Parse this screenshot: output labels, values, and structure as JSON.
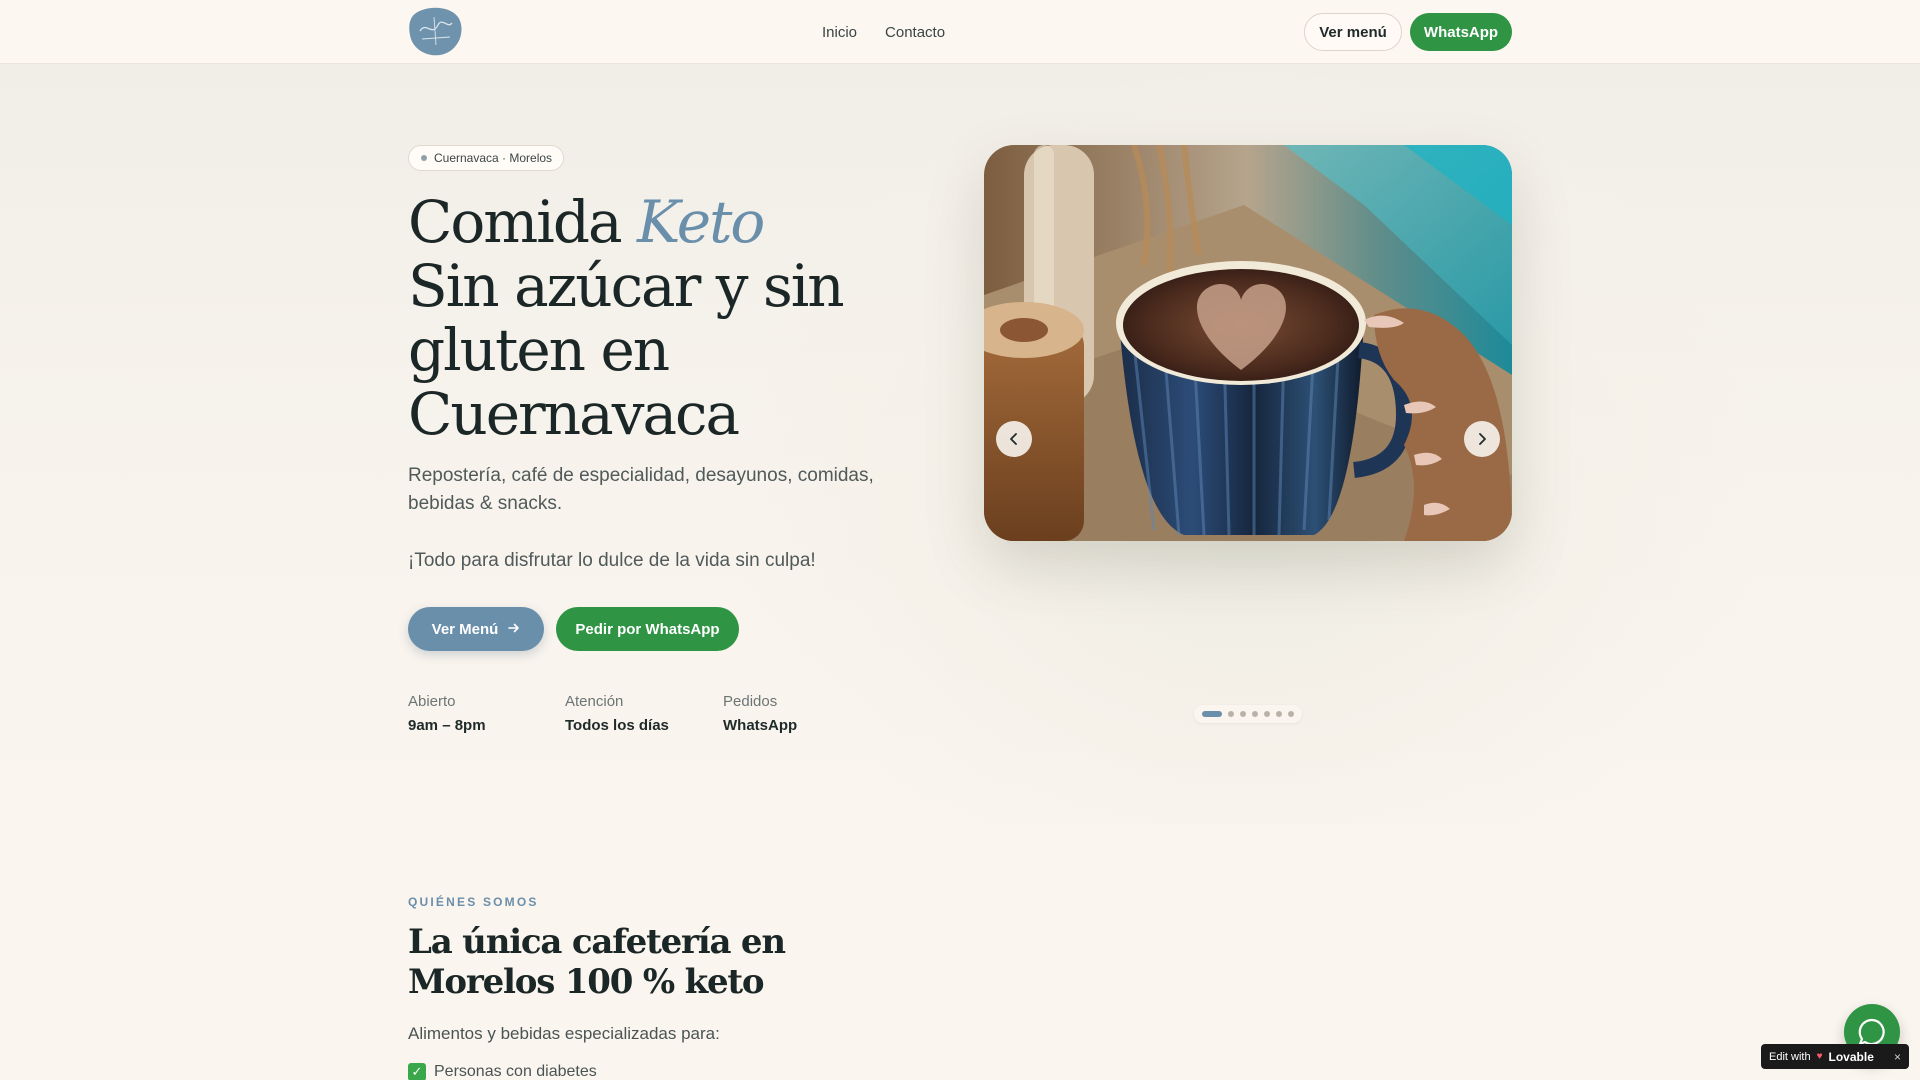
{
  "nav": {
    "links": [
      "Inicio",
      "Contacto"
    ],
    "menu_button": "Ver menú",
    "whatsapp_button": "WhatsApp"
  },
  "hero": {
    "location_pill": "Cuernavaca · Morelos",
    "title_part1": "Comida ",
    "title_highlight": "Keto",
    "title_part2": "Sin azúcar y sin gluten en Cuernavaca",
    "subtitle": "Repostería, café de especialidad, desayunos, comidas, bebidas & snacks.",
    "tagline": "¡Todo para disfrutar lo dulce de la vida sin culpa!",
    "cta_menu": "Ver Menú",
    "cta_whatsapp": "Pedir por WhatsApp",
    "info": [
      {
        "label": "Abierto",
        "value": "9am – 8pm"
      },
      {
        "label": "Atención",
        "value": "Todos los días"
      },
      {
        "label": "Pedidos",
        "value": "WhatsApp"
      }
    ]
  },
  "carousel": {
    "slide_count": 7,
    "active_slide": 1
  },
  "about": {
    "eyebrow": "QUIÉNES SOMOS",
    "title": "La única cafetería en Morelos 100 % keto",
    "text": "Alimentos y bebidas especializadas para:",
    "items": [
      "Personas con diabetes"
    ]
  },
  "badge": {
    "prefix": "Edit with",
    "brand": "Lovable",
    "close": "×"
  },
  "colors": {
    "accent_blue": "#6a8fab",
    "whatsapp_green": "#2f9443",
    "background": "#fbf5ef"
  },
  "icons": {
    "logo": "brand-logo-icon",
    "arrow": "arrow-right-icon",
    "prev": "chevron-left-icon",
    "next": "chevron-right-icon",
    "chat": "whatsapp-chat-icon",
    "check": "check-icon"
  }
}
